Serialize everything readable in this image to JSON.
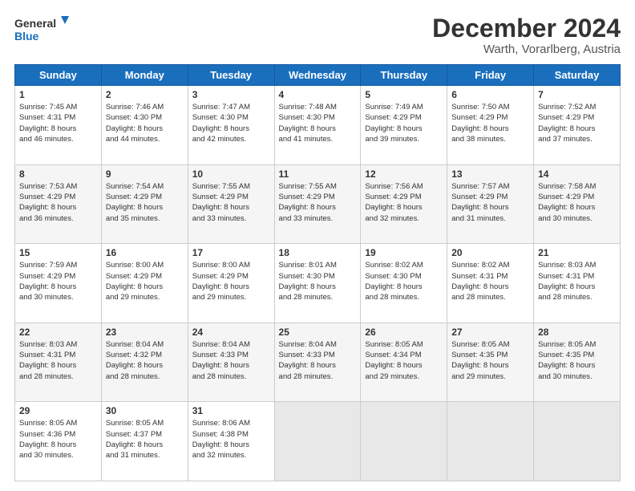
{
  "header": {
    "logo_line1": "General",
    "logo_line2": "Blue",
    "month": "December 2024",
    "location": "Warth, Vorarlberg, Austria"
  },
  "days_of_week": [
    "Sunday",
    "Monday",
    "Tuesday",
    "Wednesday",
    "Thursday",
    "Friday",
    "Saturday"
  ],
  "weeks": [
    [
      {
        "num": "1",
        "info": "Sunrise: 7:45 AM\nSunset: 4:31 PM\nDaylight: 8 hours\nand 46 minutes."
      },
      {
        "num": "2",
        "info": "Sunrise: 7:46 AM\nSunset: 4:30 PM\nDaylight: 8 hours\nand 44 minutes."
      },
      {
        "num": "3",
        "info": "Sunrise: 7:47 AM\nSunset: 4:30 PM\nDaylight: 8 hours\nand 42 minutes."
      },
      {
        "num": "4",
        "info": "Sunrise: 7:48 AM\nSunset: 4:30 PM\nDaylight: 8 hours\nand 41 minutes."
      },
      {
        "num": "5",
        "info": "Sunrise: 7:49 AM\nSunset: 4:29 PM\nDaylight: 8 hours\nand 39 minutes."
      },
      {
        "num": "6",
        "info": "Sunrise: 7:50 AM\nSunset: 4:29 PM\nDaylight: 8 hours\nand 38 minutes."
      },
      {
        "num": "7",
        "info": "Sunrise: 7:52 AM\nSunset: 4:29 PM\nDaylight: 8 hours\nand 37 minutes."
      }
    ],
    [
      {
        "num": "8",
        "info": "Sunrise: 7:53 AM\nSunset: 4:29 PM\nDaylight: 8 hours\nand 36 minutes."
      },
      {
        "num": "9",
        "info": "Sunrise: 7:54 AM\nSunset: 4:29 PM\nDaylight: 8 hours\nand 35 minutes."
      },
      {
        "num": "10",
        "info": "Sunrise: 7:55 AM\nSunset: 4:29 PM\nDaylight: 8 hours\nand 33 minutes."
      },
      {
        "num": "11",
        "info": "Sunrise: 7:55 AM\nSunset: 4:29 PM\nDaylight: 8 hours\nand 33 minutes."
      },
      {
        "num": "12",
        "info": "Sunrise: 7:56 AM\nSunset: 4:29 PM\nDaylight: 8 hours\nand 32 minutes."
      },
      {
        "num": "13",
        "info": "Sunrise: 7:57 AM\nSunset: 4:29 PM\nDaylight: 8 hours\nand 31 minutes."
      },
      {
        "num": "14",
        "info": "Sunrise: 7:58 AM\nSunset: 4:29 PM\nDaylight: 8 hours\nand 30 minutes."
      }
    ],
    [
      {
        "num": "15",
        "info": "Sunrise: 7:59 AM\nSunset: 4:29 PM\nDaylight: 8 hours\nand 30 minutes."
      },
      {
        "num": "16",
        "info": "Sunrise: 8:00 AM\nSunset: 4:29 PM\nDaylight: 8 hours\nand 29 minutes."
      },
      {
        "num": "17",
        "info": "Sunrise: 8:00 AM\nSunset: 4:29 PM\nDaylight: 8 hours\nand 29 minutes."
      },
      {
        "num": "18",
        "info": "Sunrise: 8:01 AM\nSunset: 4:30 PM\nDaylight: 8 hours\nand 28 minutes."
      },
      {
        "num": "19",
        "info": "Sunrise: 8:02 AM\nSunset: 4:30 PM\nDaylight: 8 hours\nand 28 minutes."
      },
      {
        "num": "20",
        "info": "Sunrise: 8:02 AM\nSunset: 4:31 PM\nDaylight: 8 hours\nand 28 minutes."
      },
      {
        "num": "21",
        "info": "Sunrise: 8:03 AM\nSunset: 4:31 PM\nDaylight: 8 hours\nand 28 minutes."
      }
    ],
    [
      {
        "num": "22",
        "info": "Sunrise: 8:03 AM\nSunset: 4:31 PM\nDaylight: 8 hours\nand 28 minutes."
      },
      {
        "num": "23",
        "info": "Sunrise: 8:04 AM\nSunset: 4:32 PM\nDaylight: 8 hours\nand 28 minutes."
      },
      {
        "num": "24",
        "info": "Sunrise: 8:04 AM\nSunset: 4:33 PM\nDaylight: 8 hours\nand 28 minutes."
      },
      {
        "num": "25",
        "info": "Sunrise: 8:04 AM\nSunset: 4:33 PM\nDaylight: 8 hours\nand 28 minutes."
      },
      {
        "num": "26",
        "info": "Sunrise: 8:05 AM\nSunset: 4:34 PM\nDaylight: 8 hours\nand 29 minutes."
      },
      {
        "num": "27",
        "info": "Sunrise: 8:05 AM\nSunset: 4:35 PM\nDaylight: 8 hours\nand 29 minutes."
      },
      {
        "num": "28",
        "info": "Sunrise: 8:05 AM\nSunset: 4:35 PM\nDaylight: 8 hours\nand 30 minutes."
      }
    ],
    [
      {
        "num": "29",
        "info": "Sunrise: 8:05 AM\nSunset: 4:36 PM\nDaylight: 8 hours\nand 30 minutes."
      },
      {
        "num": "30",
        "info": "Sunrise: 8:05 AM\nSunset: 4:37 PM\nDaylight: 8 hours\nand 31 minutes."
      },
      {
        "num": "31",
        "info": "Sunrise: 8:06 AM\nSunset: 4:38 PM\nDaylight: 8 hours\nand 32 minutes."
      },
      {
        "num": "",
        "info": ""
      },
      {
        "num": "",
        "info": ""
      },
      {
        "num": "",
        "info": ""
      },
      {
        "num": "",
        "info": ""
      }
    ]
  ]
}
